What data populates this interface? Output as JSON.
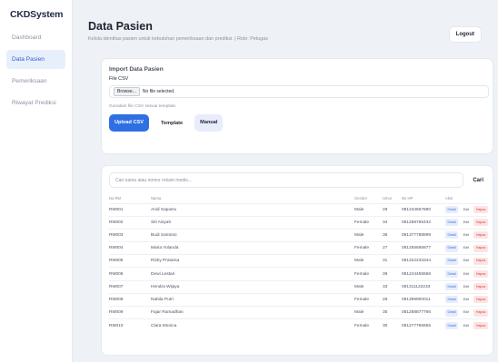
{
  "brand": "CKDSystem",
  "sidebar": {
    "items": [
      {
        "label": "Dashboard",
        "active": false
      },
      {
        "label": "Data Pasien",
        "active": true
      },
      {
        "label": "Pemeriksaan",
        "active": false
      },
      {
        "label": "Riwayat Prediksi",
        "active": false
      }
    ]
  },
  "header": {
    "title": "Data Pasien",
    "subtitle": "Kelola identitas pasien untuk kebutuhan pemeriksaan dan prediksi. | Role: Petugas",
    "logout_label": "Logout"
  },
  "import": {
    "title": "Import Data Pasien",
    "file_label": "File CSV",
    "browse_label": "Browse...",
    "no_file_text": "No file selected.",
    "hint": "Gunakan file CSV sesuai template.",
    "upload_label": "Upload CSV",
    "template_label": "Template",
    "manual_label": "Manual"
  },
  "search": {
    "placeholder": "Cari nama atau nomor rekam medis...",
    "button_label": "Cari"
  },
  "table": {
    "headers": {
      "no_rm": "No RM",
      "nama": "Nama",
      "gender": "Gender",
      "umur": "Umur",
      "no_hp": "No HP",
      "aksi": "Aksi"
    },
    "actions": {
      "detail": "Detail",
      "edit": "Edit",
      "hapus": "Hapus"
    },
    "rows": [
      {
        "no_rm": "RM001",
        "nama": "Andi Saputra",
        "gender": "Male",
        "umur": "29",
        "no_hp": "081234567890"
      },
      {
        "no_rm": "RM002",
        "nama": "Siti Aisyah",
        "gender": "Female",
        "umur": "34",
        "no_hp": "081298765432"
      },
      {
        "no_rm": "RM003",
        "nama": "Budi Santoso",
        "gender": "Male",
        "umur": "36",
        "no_hp": "081377788899"
      },
      {
        "no_rm": "RM004",
        "nama": "Maria Yolanda",
        "gender": "Female",
        "umur": "27",
        "no_hp": "081255566677"
      },
      {
        "no_rm": "RM005",
        "nama": "Rizky Pratama",
        "gender": "Male",
        "umur": "31",
        "no_hp": "081322233344"
      },
      {
        "no_rm": "RM006",
        "nama": "Dewi Lestari",
        "gender": "Female",
        "umur": "39",
        "no_hp": "081244455566"
      },
      {
        "no_rm": "RM007",
        "nama": "Hendra Wijaya",
        "gender": "Male",
        "umur": "33",
        "no_hp": "081311122233"
      },
      {
        "no_rm": "RM008",
        "nama": "Nabila Putri",
        "gender": "Female",
        "umur": "26",
        "no_hp": "081399900011"
      },
      {
        "no_rm": "RM009",
        "nama": "Fajar Ramadhan",
        "gender": "Male",
        "umur": "35",
        "no_hp": "081288877766"
      },
      {
        "no_rm": "RM010",
        "nama": "Clara Monica",
        "gender": "Female",
        "umur": "30",
        "no_hp": "081277766655"
      }
    ]
  },
  "colors": {
    "accent": "#2f6fe4",
    "danger": "#d33b3b",
    "background": "#eef1f6"
  }
}
